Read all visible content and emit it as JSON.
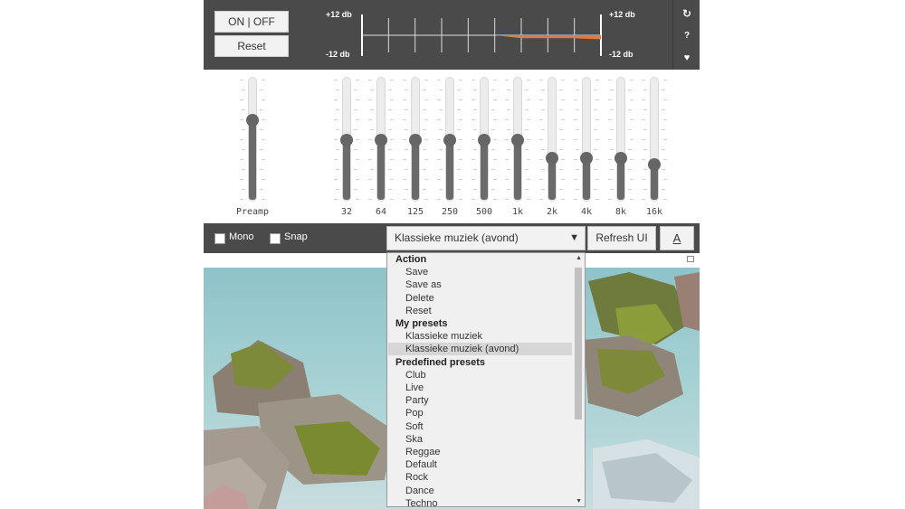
{
  "buttons": {
    "onoff": "ON | OFF",
    "reset": "Reset"
  },
  "graph": {
    "top_left": "+12 db",
    "bottom_left": "-12 db",
    "top_right": "+12 db",
    "bottom_right": "-12 db",
    "curve_color": "#e07a45"
  },
  "side_icons": [
    {
      "name": "refresh-icon",
      "glyph": "↻"
    },
    {
      "name": "help-icon",
      "glyph": "?"
    },
    {
      "name": "heart-icon",
      "glyph": "♥"
    }
  ],
  "sliders": [
    {
      "label": "Preamp",
      "level": 0.68
    },
    {
      "label": "32",
      "level": 0.5
    },
    {
      "label": "64",
      "level": 0.5
    },
    {
      "label": "125",
      "level": 0.5
    },
    {
      "label": "250",
      "level": 0.5
    },
    {
      "label": "500",
      "level": 0.5
    },
    {
      "label": "1k",
      "level": 0.5
    },
    {
      "label": "2k",
      "level": 0.34
    },
    {
      "label": "4k",
      "level": 0.34
    },
    {
      "label": "8k",
      "level": 0.34
    },
    {
      "label": "16k",
      "level": 0.28
    }
  ],
  "controls": {
    "mono_label": "Mono",
    "snap_label": "Snap",
    "preset_selected": "Klassieke muziek (avond)",
    "refresh_label": "Refresh UI",
    "font_glyph": "A"
  },
  "dropdown": {
    "groups": [
      {
        "title": "Action",
        "items": [
          "Save",
          "Save as",
          "Delete",
          "Reset"
        ]
      },
      {
        "title": "My presets",
        "items": [
          "Klassieke muziek",
          "Klassieke muziek (avond)"
        ]
      },
      {
        "title": "Predefined presets",
        "items": [
          "Club",
          "Live",
          "Party",
          "Pop",
          "Soft",
          "Ska",
          "Reggae",
          "Default",
          "Rock",
          "Dance",
          "Techno"
        ]
      }
    ],
    "selected": "Klassieke muziek (avond)"
  }
}
